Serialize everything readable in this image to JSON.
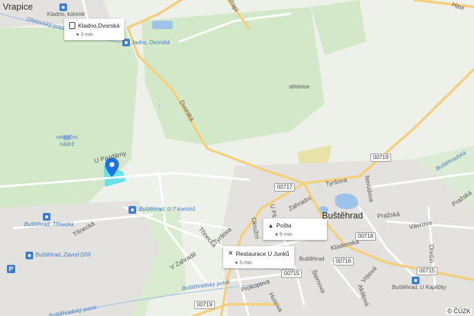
{
  "map": {
    "colors": {
      "background": "#eef0ea",
      "green": "#cde6c3",
      "road": "#ffffff",
      "main_road": "#f7d27e",
      "water": "#9cc3ea",
      "urban": "#e2e0dc",
      "marker": "#1a73e8",
      "highlight": "#4fe0ee"
    },
    "towns": {
      "vrapice": "Vrapice",
      "bustehrad": "Buštěhrad"
    },
    "places": {
      "kladno_kolonie": "Kladno, kolonie",
      "jadno_dvorska": "Jadno, Dvorská",
      "bustehrad_u7": "Buštěhrad, U 7 komínů",
      "bustehrad_trinecka": "Buštěhrad, Třinecká",
      "bustehrad_zavod": "Buštěhrad, Závod Dříň",
      "bustehrad_kaplicky": "Buštěhrad, U Kapličky",
      "bustehrad_place": "Buštěhrad",
      "retencni": "retenční nádrž",
      "strelnice": "střelnice",
      "dretovicky_potok": "Dřetovický potok",
      "bustehradsky_potok": "Buštěhradský potok",
      "bustehradsky_potok2": "Buštěhradský potok",
      "u_pazdarny": "U Pazdárny",
      "havl": "Havl",
      "vrapi_road": "Vrapi"
    },
    "streets": {
      "dvorska": "Dvorská",
      "trinecka": "Třinecká",
      "trinecka2": "Třinecká",
      "tyrsova": "Tyršova",
      "tyrsova2": "Tyršova",
      "zahradni": "Zahradní",
      "u_pristavu": "U Pš",
      "okruzni": "Okružní",
      "kladenska": "Kladenská",
      "vrbova": "Vrbová",
      "sternova": "Šternova",
      "prokopova": "Prokopova",
      "husova": "Husova",
      "akatova": "Akátová",
      "prazska": "Pražská",
      "prazska2": "Pražská",
      "vavrova": "Vávrova",
      "oresin": "Orešín",
      "v_zahrade": "V Zahradě",
      "nerudova": "Nerudova",
      "bustehradska": "Buštěhradská"
    },
    "shields": {
      "r719a": "00719",
      "r717": "00717",
      "r718": "00718",
      "r716": "00716",
      "r715a": "00715",
      "r715b": "00715",
      "r719b": "00719"
    },
    "pois": {
      "bus": {
        "name": "Kladno,Dvorská",
        "eta": "3 min",
        "icon": "bus-icon"
      },
      "post": {
        "name": "Pošta",
        "eta": "5 min",
        "icon": "post-icon"
      },
      "restaurant": {
        "name": "Restaurace U Junků",
        "eta": "5 min",
        "icon": "fork-knife-icon"
      }
    },
    "parking": "P",
    "copyright": "© ČÚZK"
  }
}
